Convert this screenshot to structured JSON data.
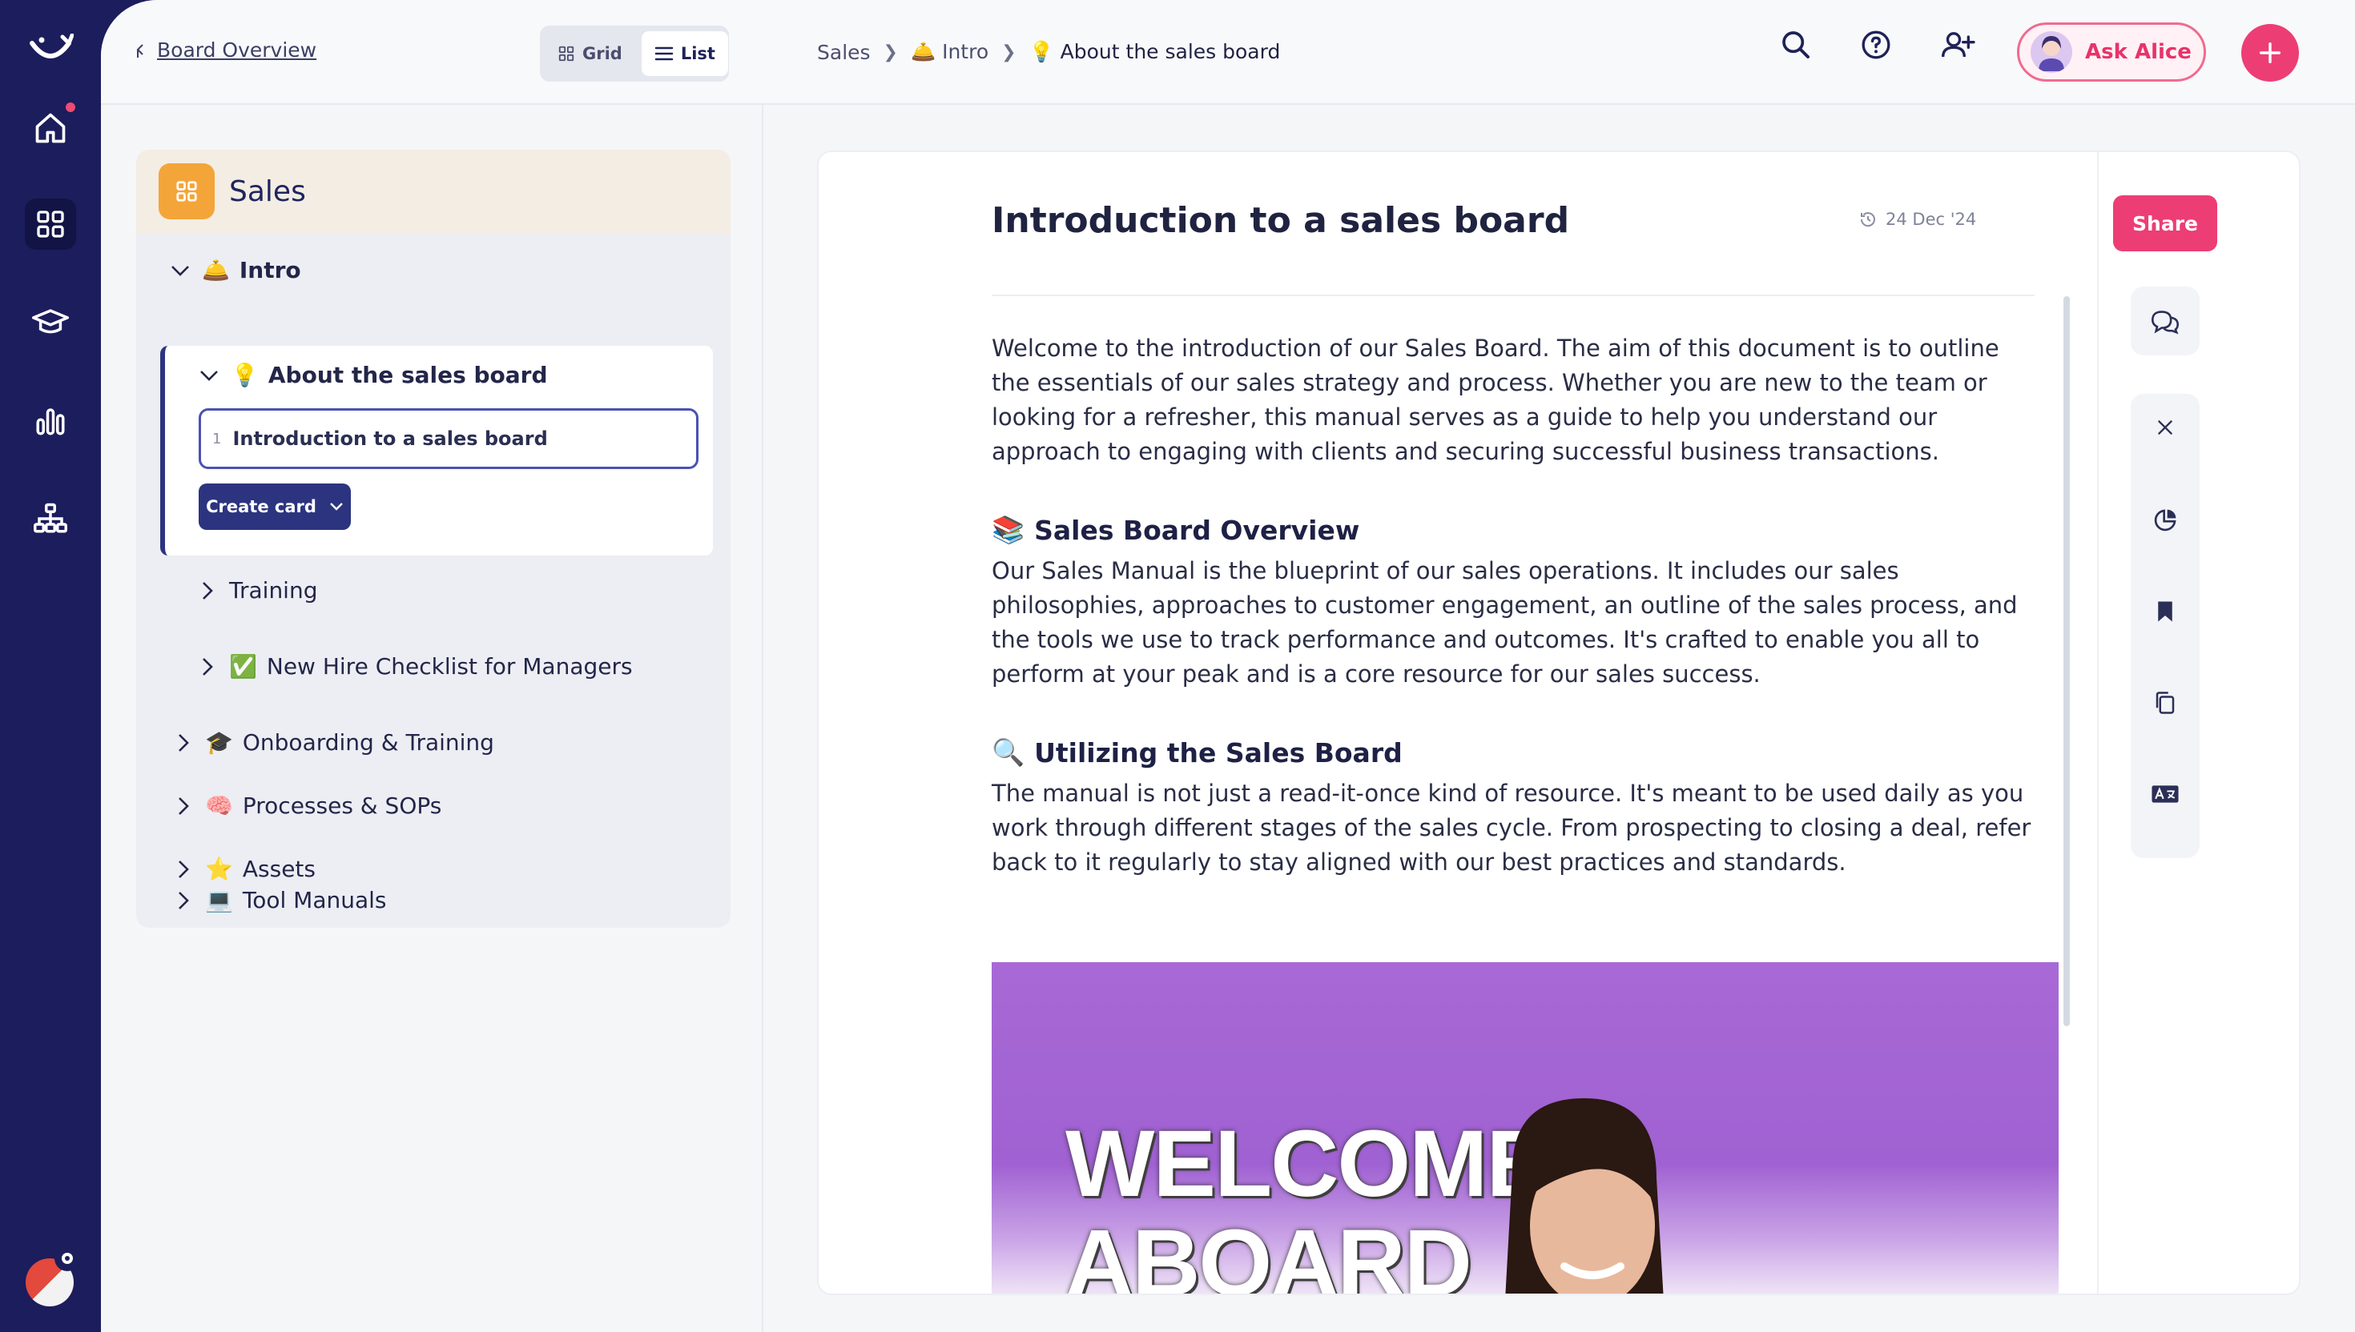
{
  "rail": {
    "icons": [
      "logo-icon",
      "home-icon",
      "grid-icon",
      "graduation-cap-icon",
      "bar-chart-icon",
      "org-chart-icon"
    ],
    "accent": "#ee4a73"
  },
  "topbar": {
    "back_label": "Board Overview",
    "view_toggle": {
      "grid": "Grid",
      "list": "List",
      "selected": "List"
    },
    "breadcrumb": {
      "first": "Sales",
      "second_emoji": "🛎️",
      "second": "Intro",
      "third_emoji": "💡",
      "third": "About the sales board"
    },
    "ask_label": "Ask Alice"
  },
  "tree": {
    "header_title": "Sales",
    "intro_emoji": "🛎️",
    "intro_label": "Intro",
    "about_emoji": "💡",
    "about_label": "About the sales board",
    "selected_number": "1",
    "selected_label": "Introduction to a sales board",
    "create_label": "Create card",
    "training_label": "Training",
    "checklist_emoji": "✅",
    "checklist_label": "New Hire Checklist for Managers",
    "onboarding_emoji": "🎓",
    "onboarding_label": "Onboarding & Training",
    "processes_emoji": "🧠",
    "processes_label": "Processes & SOPs",
    "assets_emoji": "⭐",
    "assets_label": "Assets",
    "tools_emoji": "💻",
    "tools_label": "Tool Manuals"
  },
  "doc": {
    "title": "Introduction to a sales board",
    "date": "24 Dec '24",
    "intro_paragraph": "Welcome to the introduction of our Sales Board. The aim of this document is to outline the essentials of our sales strategy and process. Whether you are new to the team or looking for a refresher, this manual serves as a guide to help you understand our approach to engaging with clients and securing successful business transactions.",
    "section1_emoji": "📚",
    "section1_title": "Sales Board Overview",
    "section1_text": "Our Sales Manual is the blueprint of our sales operations. It includes our sales philosophies, approaches to customer engagement, an outline of the sales process, and the tools we use to track performance and outcomes. It's crafted to enable you all to perform at your peak and is a core resource for our sales success.",
    "section2_emoji": "🔍",
    "section2_title": "Utilizing the Sales Board",
    "section2_text": "The manual is not just a read-it-once kind of resource. It's meant to be used daily as you work through different stages of the sales cycle. From prospecting to closing a deal, refer back to it regularly to stay aligned with our best practices and standards.",
    "image_text_line1": "WELCOME",
    "image_text_line2": "ABOARD"
  },
  "tools": {
    "share_label": "Share",
    "icons": [
      "comments-icon",
      "close-icon",
      "pie-chart-icon",
      "bookmark-icon",
      "copy-icon",
      "translate-icon"
    ]
  },
  "colors": {
    "navy": "#1c1d5c",
    "pink": "#ec3e74",
    "orange": "#f4a53a"
  }
}
